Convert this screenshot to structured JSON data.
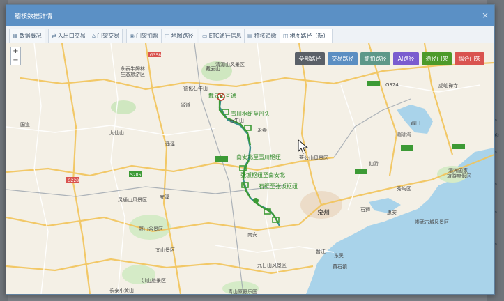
{
  "modal": {
    "title": "稽核数据详情",
    "close": "×"
  },
  "tabs": [
    {
      "label": "数据概况",
      "icon": "▦",
      "active": false
    },
    {
      "label": "入出口交易",
      "icon": "⇄",
      "active": false
    },
    {
      "label": "门架交易",
      "icon": "⌂",
      "active": false
    },
    {
      "label": "门架拍照",
      "icon": "◉",
      "active": false
    },
    {
      "label": "地图路径",
      "icon": "◫",
      "active": false
    },
    {
      "label": "ETC通行信息",
      "icon": "▭",
      "active": false
    },
    {
      "label": "稽核追缴",
      "icon": "▤",
      "active": false
    },
    {
      "label": "地图路径（新）",
      "icon": "◫",
      "active": true
    }
  ],
  "map": {
    "zoom_in": "+",
    "zoom_out": "−",
    "labels": [
      {
        "text": "永泰牛姆林"
      },
      {
        "text": "生态旅游区"
      },
      {
        "text": "德化石牛山"
      },
      {
        "text": "戴云山"
      },
      {
        "text": "九仙山"
      },
      {
        "text": "省道"
      },
      {
        "text": "国道"
      },
      {
        "text": "涌溪"
      },
      {
        "text": "泉州"
      },
      {
        "text": "石狮"
      },
      {
        "text": "晋江"
      },
      {
        "text": "南安"
      },
      {
        "text": "安溪"
      },
      {
        "text": "永春"
      },
      {
        "text": "仙游"
      },
      {
        "text": "莆田"
      },
      {
        "text": "湄洲国家"
      },
      {
        "text": "旅游度假区"
      },
      {
        "text": "野山谷景区"
      },
      {
        "text": "文山景区"
      },
      {
        "text": "洪山旅景区"
      },
      {
        "text": "长泰小黄山"
      },
      {
        "text": "青山原野乐园"
      },
      {
        "text": "崇武古城风景区"
      },
      {
        "text": "惠安"
      },
      {
        "text": "秀屿区"
      },
      {
        "text": "湄洲湾"
      },
      {
        "text": "东吴"
      },
      {
        "text": "黄石镇"
      },
      {
        "text": "G324"
      },
      {
        "text": "G358"
      },
      {
        "text": "G228"
      },
      {
        "text": "S206"
      },
      {
        "text": "清源山风景区"
      },
      {
        "text": "九日山风景区"
      },
      {
        "text": "菩公山风景区"
      },
      {
        "text": "虎岫禅寺"
      },
      {
        "text": "石牛山"
      },
      {
        "text": "灵通山风景区"
      }
    ],
    "route_labels": [
      {
        "text": "戴云山互通"
      },
      {
        "text": "雪川枢纽至丹头"
      },
      {
        "text": "南安北至雪川枢纽"
      },
      {
        "text": "张坂枢纽至南安北"
      },
      {
        "text": "石壁至张坂枢纽"
      }
    ],
    "buttons": [
      {
        "label": "全部路径",
        "color": "#5a6068"
      },
      {
        "label": "交易路径",
        "color": "#5b8ec2"
      },
      {
        "label": "抓拍路径",
        "color": "#5d9889"
      },
      {
        "label": "AI路径",
        "color": "#7a5ccf"
      },
      {
        "label": "途径门架",
        "color": "#4c9a2a"
      },
      {
        "label": "拟合门架",
        "color": "#d9534f"
      }
    ],
    "route_color": "#3c9a35",
    "route_line_color": "#3a8f8f"
  },
  "side_icons": [
    "search-icon",
    "gear-icon"
  ]
}
